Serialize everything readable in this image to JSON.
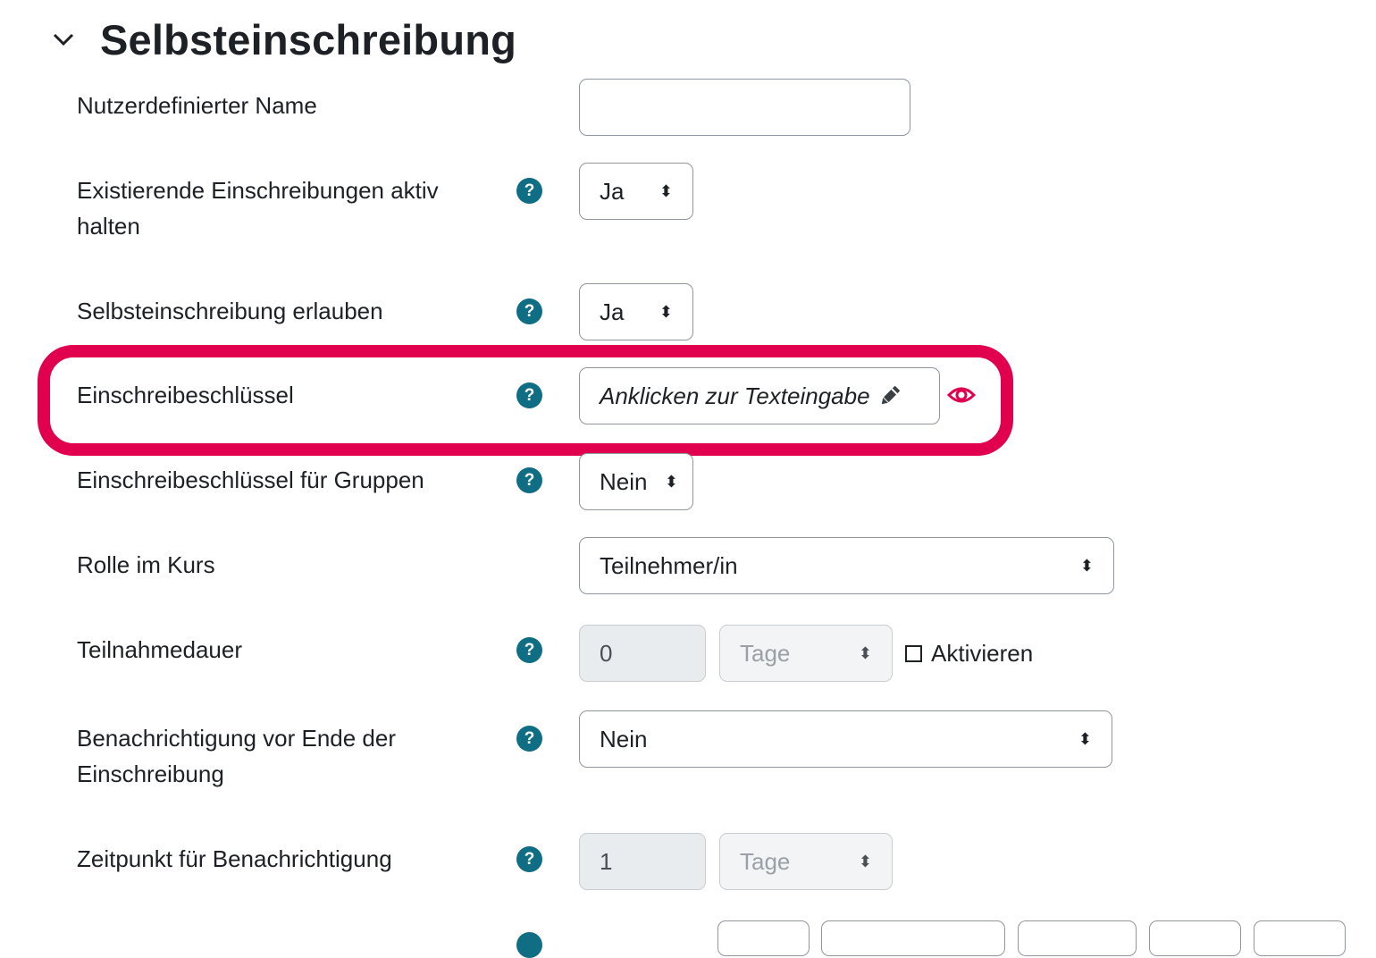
{
  "section": {
    "title": "Selbsteinschreibung",
    "icon": "chevron-down-icon"
  },
  "fields": {
    "custom_name": {
      "label": "Nutzerdefinierter Name",
      "value": ""
    },
    "keep_enrolments": {
      "label": "Existierende Einschreibungen aktiv halten",
      "value": "Ja"
    },
    "allow_self_enrol": {
      "label": "Selbsteinschreibung erlauben",
      "value": "Ja"
    },
    "enrolment_key": {
      "label": "Einschreibeschlüssel",
      "value": "Anklicken zur Texteingabe"
    },
    "group_key": {
      "label": "Einschreibeschlüssel für Gruppen",
      "value": "Nein"
    },
    "role": {
      "label": "Rolle im Kurs",
      "value": "Teilnehmer/in"
    },
    "duration": {
      "label": "Teilnahmedauer",
      "number": "0",
      "unit": "Tage",
      "enable_label": "Aktivieren",
      "enabled": false
    },
    "notify_expiry": {
      "label": "Benachrichtigung vor Ende der Einschreibung",
      "value": "Nein"
    },
    "notify_threshold": {
      "label": "Zeitpunkt für Benachrichtigung",
      "number": "1",
      "unit": "Tage"
    }
  },
  "colors": {
    "highlight": "#e0004d",
    "help_icon": "#0f6e84",
    "eye_icon": "#e0004d"
  }
}
